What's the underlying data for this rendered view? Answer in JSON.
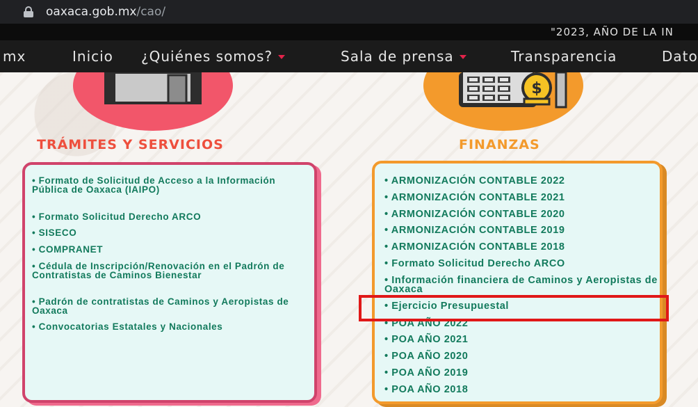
{
  "browser": {
    "url_host": "oaxaca.gob.mx",
    "url_path": "/cao/"
  },
  "banner": {
    "text": "\"2023, AÑO DE LA IN"
  },
  "nav": {
    "brand_fragment": "mx",
    "items": [
      {
        "label": "Inicio",
        "has_dropdown": false
      },
      {
        "label": "¿Quiénes somos?",
        "has_dropdown": true
      },
      {
        "label": "Sala de prensa",
        "has_dropdown": true
      },
      {
        "label": "Transparencia",
        "has_dropdown": false
      },
      {
        "label": "Dato",
        "has_dropdown": false
      }
    ]
  },
  "left": {
    "title": "TRÁMITES Y SERVICIOS",
    "icon": "building-icon",
    "items": [
      "• Formato de Solicitud de Acceso a la Información Pública de Oaxaca (IAIPO)",
      "• Formato Solicitud Derecho ARCO",
      "• SISECO",
      "• COMPRANET",
      "• Cédula de Inscripción/Renovación en el Padrón de Contratistas de Caminos Bienestar",
      "• Padrón de contratistas de Caminos y Aeropistas de Oaxaca",
      "• Convocatorias Estatales y Nacionales"
    ]
  },
  "right": {
    "title": "FINANZAS",
    "icon": "calculator-coin-icon",
    "items": [
      "• ARMONIZACIÓN CONTABLE 2022",
      "• ARMONIZACIÓN CONTABLE 2021",
      "• ARMONIZACIÓN CONTABLE 2020",
      "• ARMONIZACIÓN CONTABLE 2019",
      "• ARMONIZACIÓN CONTABLE 2018",
      "• Formato Solicitud Derecho ARCO",
      "• Información financiera de Caminos y Aeropistas de Oaxaca",
      "• Ejercicio Presupuestal",
      "• POA AÑO 2022",
      "• POA AÑO 2021",
      "• POA AÑO 2020",
      "• POA AÑO 2019",
      "• POA AÑO 2018"
    ]
  },
  "colors": {
    "accent_red": "#f2566a",
    "accent_orange": "#f39a2c",
    "link_green": "#127a5c",
    "highlight_red": "#e01818",
    "panel_bg": "#e6f8f6"
  }
}
